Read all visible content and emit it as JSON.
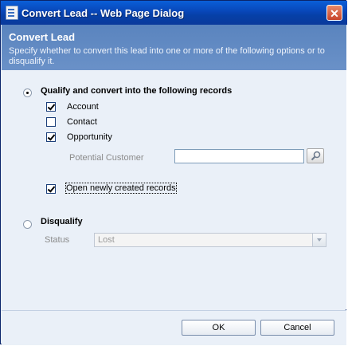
{
  "window": {
    "title": "Convert Lead -- Web Page Dialog",
    "close_glyph": "✕"
  },
  "header": {
    "title": "Convert Lead",
    "description": "Specify whether to convert this lead into one or more of the following options or to disqualify it."
  },
  "qualify": {
    "label": "Qualify and convert into the following records",
    "selected": true,
    "options": [
      {
        "label": "Account",
        "checked": true
      },
      {
        "label": "Contact",
        "checked": false
      },
      {
        "label": "Opportunity",
        "checked": true
      }
    ],
    "potential_customer_label": "Potential Customer",
    "potential_customer_value": "",
    "open_records_label": "Open newly created records",
    "open_records_checked": true
  },
  "disqualify": {
    "label": "Disqualify",
    "selected": false,
    "status_label": "Status",
    "status_value": "Lost"
  },
  "buttons": {
    "ok": "OK",
    "cancel": "Cancel"
  },
  "icons": {
    "app": "page-icon",
    "lookup": "lookup-icon",
    "close": "close-icon"
  }
}
